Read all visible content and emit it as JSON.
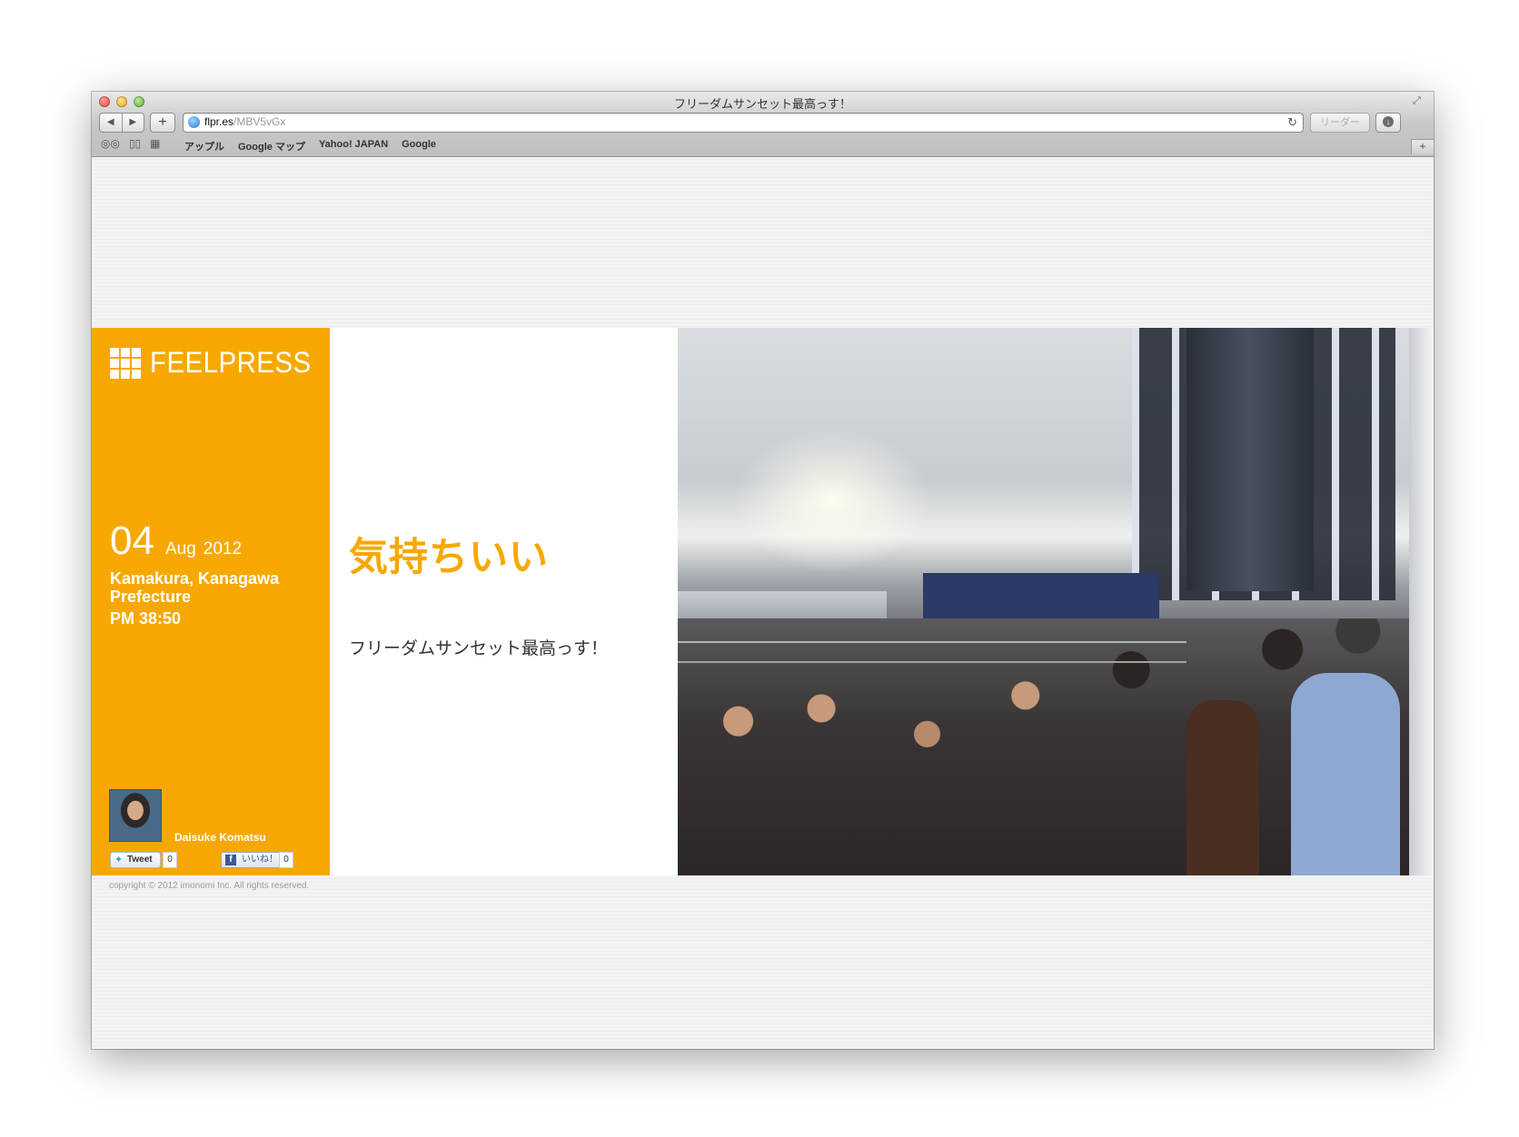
{
  "browser": {
    "window_title": "フリーダムサンセット最高っす！",
    "url_domain": "flpr.es",
    "url_path": "/MBV5vGx",
    "reader_label": "リーダー",
    "bookmarks": [
      "アップル",
      "Google マップ",
      "Yahoo! JAPAN",
      "Google"
    ]
  },
  "sidebar": {
    "logo": "FEELPRESS",
    "day": "04",
    "month": "Aug",
    "year": "2012",
    "location": "Kamakura, Kanagawa Prefecture",
    "time": "PM 38:50",
    "author": "Daisuke Komatsu",
    "tweet_label": "Tweet",
    "tweet_count": "0",
    "like_label": "いいね！",
    "like_count": "0"
  },
  "post": {
    "title": "気持ちいい",
    "body": "フリーダムサンセット最高っす！"
  },
  "footer": {
    "copyright": "copyright © 2012 imonomi Inc. All rights reserved."
  },
  "colors": {
    "accent": "#f7a800",
    "facebook": "#3b5998",
    "twitter": "#2ba9e1"
  }
}
